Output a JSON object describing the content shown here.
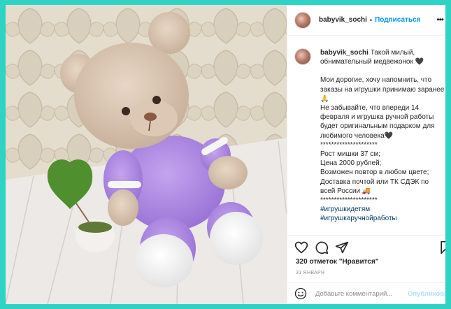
{
  "accent": "#2fd3c4",
  "link_color": "#0095f6",
  "post": {
    "username": "babyvik_sochi",
    "separator": "•",
    "follow_label": "Подписаться",
    "more_icon": "more-horizontal-icon"
  },
  "caption": {
    "username": "babyvik_sochi",
    "lines": [
      "Такой милый, обнимательный медвежонок 🖤",
      "",
      "Мои дорогие, хочу напомнить, что заказы на игрушки принимаю заранее🙏",
      "Не забывайте, что впереди 14 февраля и игрушка ручной работы будет оригинальным подарком для любимого человека🖤",
      "*********************",
      "Рост мишки 37 см;",
      "Цена 2000 рублей;",
      "Возможен повтор в любом цвете;",
      "Доставка почтой или ТК СДЭК по всей России 🚚",
      "*********************"
    ],
    "hashtags": [
      "#игрушкидетям",
      "#игрушкаручнойработы"
    ]
  },
  "actions": {
    "like_icon": "heart-icon",
    "comment_icon": "comment-icon",
    "share_icon": "share-icon",
    "save_icon": "bookmark-icon"
  },
  "likes_text": "320 отметок \"Нравится\"",
  "date_text": "31 ЯНВАРЯ",
  "comment": {
    "placeholder": "Добавьте комментарий...",
    "publish_label": "Опубликовать",
    "emoji_icon": "smile-icon"
  }
}
